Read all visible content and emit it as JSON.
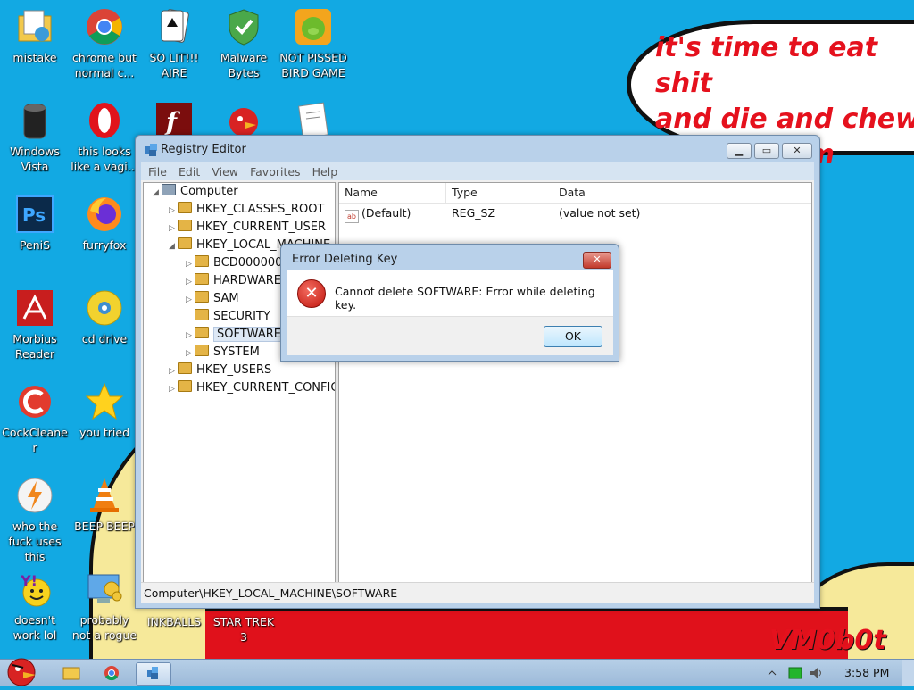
{
  "wallpaper": {
    "speech_text": "it's time to eat shit\nand die and chew\nbubble gum",
    "signature": "VM0b0t"
  },
  "desktop_icons": [
    {
      "label": "mistake",
      "icon": "folder-document-icon"
    },
    {
      "label": "chrome but normal c...",
      "icon": "chrome-icon"
    },
    {
      "label": "SO LIT!!! AIRE",
      "icon": "solitaire-cards-icon"
    },
    {
      "label": "Malware Bytes",
      "icon": "shield-check-icon"
    },
    {
      "label": "NOT PISSED BIRD GAME",
      "icon": "green-pig-icon"
    },
    {
      "label": "Windows Vista",
      "icon": "trash-bin-icon"
    },
    {
      "label": "this looks like a vagi...",
      "icon": "opera-icon"
    },
    {
      "label": "",
      "icon": "flash-icon"
    },
    {
      "label": "",
      "icon": "angry-bird-icon"
    },
    {
      "label": "",
      "icon": "document-icon"
    },
    {
      "label": "PeniS",
      "icon": "photoshop-icon"
    },
    {
      "label": "furryfox",
      "icon": "firefox-icon"
    },
    {
      "label": "Morbius Reader",
      "icon": "acrobat-icon"
    },
    {
      "label": "cd drive",
      "icon": "cd-drive-icon"
    },
    {
      "label": "CockCleaner",
      "icon": "ccleaner-icon"
    },
    {
      "label": "you tried",
      "icon": "star-icon"
    },
    {
      "label": "who the fuck uses this",
      "icon": "winamp-lightning-icon"
    },
    {
      "label": "BEEP BEEP",
      "icon": "vlc-cone-icon"
    },
    {
      "label": "doesn't work lol",
      "icon": "yahoo-messenger-icon"
    },
    {
      "label": "probably not a rogue",
      "icon": "control-panel-icon"
    },
    {
      "label": "INKBALLS",
      "icon": ""
    },
    {
      "label": "STAR TREK 3",
      "icon": ""
    }
  ],
  "registry": {
    "title": "Registry Editor",
    "menu": [
      "File",
      "Edit",
      "View",
      "Favorites",
      "Help"
    ],
    "caption_buttons": {
      "minimize": "▁",
      "maximize": "▭",
      "close": "✕"
    },
    "tree": [
      {
        "label": "Computer",
        "arrow": "◢"
      },
      {
        "label": "HKEY_CLASSES_ROOT",
        "arrow": "▷"
      },
      {
        "label": "HKEY_CURRENT_USER",
        "arrow": "▷"
      },
      {
        "label": "HKEY_LOCAL_MACHINE",
        "arrow": "◢"
      },
      {
        "label": "BCD00000000",
        "arrow": "▷"
      },
      {
        "label": "HARDWARE",
        "arrow": "▷"
      },
      {
        "label": "SAM",
        "arrow": "▷"
      },
      {
        "label": "SECURITY",
        "arrow": ""
      },
      {
        "label": "SOFTWARE",
        "arrow": "▷"
      },
      {
        "label": "SYSTEM",
        "arrow": "▷"
      },
      {
        "label": "HKEY_USERS",
        "arrow": "▷"
      },
      {
        "label": "HKEY_CURRENT_CONFIG",
        "arrow": "▷"
      }
    ],
    "columns": [
      "Name",
      "Type",
      "Data"
    ],
    "rows": [
      {
        "name": "(Default)",
        "type": "REG_SZ",
        "data": "(value not set)",
        "icon_text": "ab"
      }
    ],
    "status_path": "Computer\\HKEY_LOCAL_MACHINE\\SOFTWARE"
  },
  "error_dialog": {
    "title": "Error Deleting Key",
    "message": "Cannot delete SOFTWARE:  Error while deleting key.",
    "ok_label": "OK",
    "close_glyph": "✕",
    "error_glyph": "✕"
  },
  "taskbar": {
    "clock": "3:58 PM",
    "items": [
      "explorer-icon",
      "chrome-icon",
      "registry-editor-icon"
    ]
  }
}
